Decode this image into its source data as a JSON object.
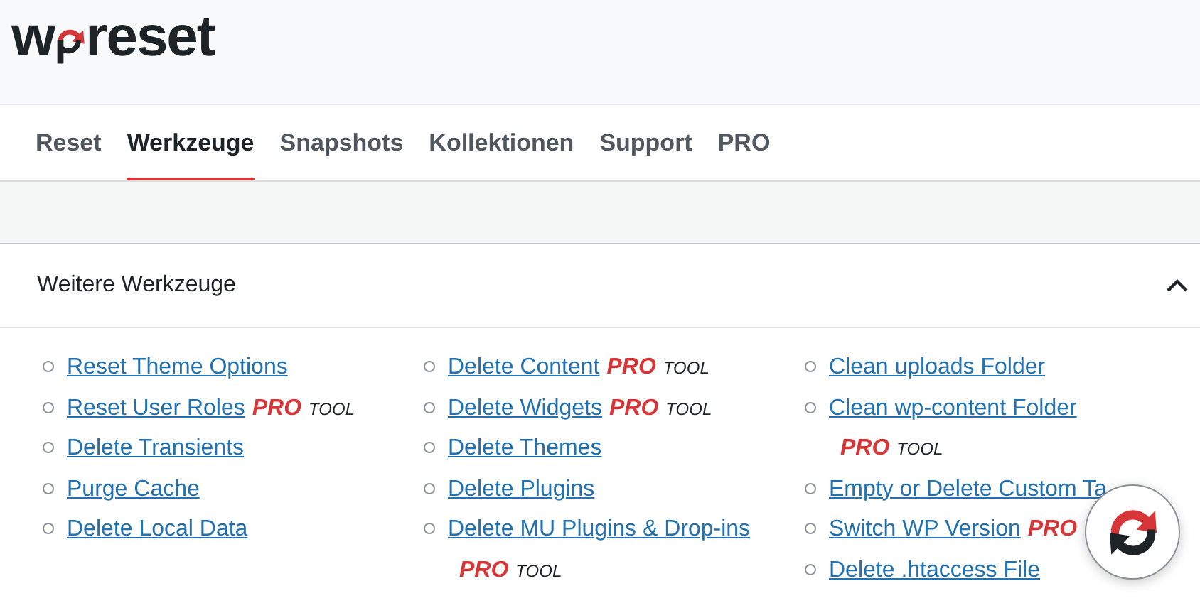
{
  "logo": {
    "before": "w",
    "after": "reset"
  },
  "tabs": [
    {
      "label": "Reset",
      "selected": false
    },
    {
      "label": "Werkzeuge",
      "selected": true
    },
    {
      "label": "Snapshots",
      "selected": false
    },
    {
      "label": "Kollektionen",
      "selected": false
    },
    {
      "label": "Support",
      "selected": false
    },
    {
      "label": "PRO",
      "selected": false
    }
  ],
  "panel": {
    "title": "Weitere Werkzeuge",
    "expanded": true,
    "columns": [
      [
        {
          "label": "Reset Theme Options"
        },
        {
          "label": "Reset User Roles",
          "pro": "PRO",
          "tool": "TOOL",
          "pro_newline": false
        },
        {
          "label": "Delete Transients"
        },
        {
          "label": "Purge Cache"
        },
        {
          "label": "Delete Local Data"
        }
      ],
      [
        {
          "label": "Delete Content",
          "pro": "PRO",
          "tool": "TOOL",
          "pro_newline": false
        },
        {
          "label": "Delete Widgets",
          "pro": "PRO",
          "tool": "TOOL",
          "pro_newline": false
        },
        {
          "label": "Delete Themes"
        },
        {
          "label": "Delete Plugins"
        },
        {
          "label": "Delete MU Plugins & Drop-ins",
          "pro": "PRO",
          "tool": "TOOL",
          "pro_newline": true
        }
      ],
      [
        {
          "label": "Clean uploads Folder"
        },
        {
          "label": "Clean wp-content Folder",
          "pro": "PRO",
          "tool": "TOOL",
          "pro_newline": true
        },
        {
          "label": "Empty or Delete Custom Ta"
        },
        {
          "label": "Switch WP Version",
          "pro": "PRO",
          "pro_newline": false
        },
        {
          "label": "Delete .htaccess File"
        }
      ]
    ]
  }
}
